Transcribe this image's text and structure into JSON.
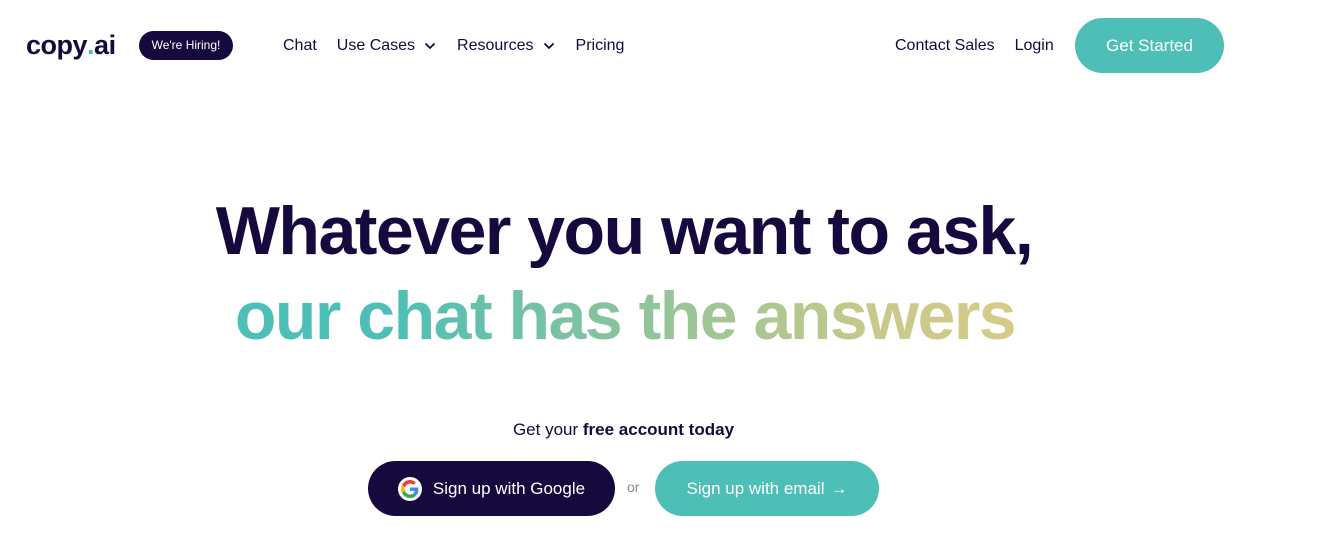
{
  "header": {
    "logo": {
      "main": "copy",
      "dot": ".",
      "suffix": "ai"
    },
    "hiring_badge": "We're Hiring!",
    "nav_left": [
      {
        "label": "Chat",
        "has_dropdown": false
      },
      {
        "label": "Use Cases",
        "has_dropdown": true
      },
      {
        "label": "Resources",
        "has_dropdown": true
      },
      {
        "label": "Pricing",
        "has_dropdown": false
      }
    ],
    "nav_right": [
      {
        "label": "Contact Sales"
      },
      {
        "label": "Login"
      }
    ],
    "cta": "Get Started"
  },
  "hero": {
    "headline_line1": "Whatever you want to ask,",
    "headline_line2": "our chat has the answers",
    "subtitle_prefix": "Get your ",
    "subtitle_bold": "free account today",
    "google_button": "Sign up with Google",
    "or_text": "or",
    "email_button": "Sign up with email",
    "email_button_arrow": "→"
  },
  "colors": {
    "navy": "#16093d",
    "teal": "#4dbfb6",
    "gradient_end": "#dccd87"
  },
  "icons": {
    "dropdown": "chevron-down-icon",
    "google": "google-icon",
    "arrow": "arrow-right-icon"
  }
}
